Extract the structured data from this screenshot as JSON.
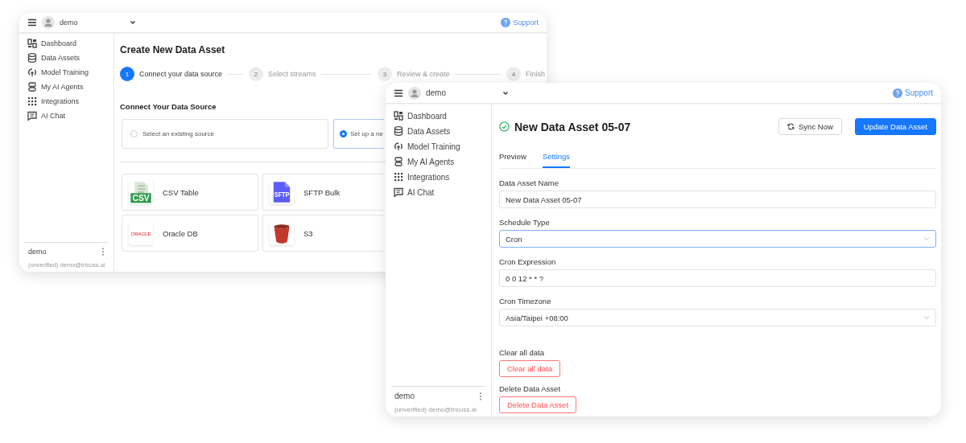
{
  "back_window": {
    "header": {
      "user": "demo",
      "support": "Support"
    },
    "sidebar": {
      "items": [
        {
          "label": "Dashboard",
          "selected": false
        },
        {
          "label": "Data Assets",
          "selected": false
        },
        {
          "label": "Model Training",
          "selected": false
        },
        {
          "label": "My AI Agents",
          "selected": false
        },
        {
          "label": "Integrations",
          "selected": false
        },
        {
          "label": "AI Chat",
          "selected": false
        }
      ],
      "user": {
        "name": "demo",
        "email": "(unverified) demo@tricuss.ai"
      }
    },
    "title": "Create New Data Asset",
    "steps": [
      {
        "number": "1",
        "label": "Connect your data source",
        "selected": true
      },
      {
        "number": "2",
        "label": "Select streams",
        "selected": false
      },
      {
        "number": "3",
        "label": "Review & create",
        "selected": false
      },
      {
        "number": "4",
        "label": "Finish",
        "selected": false
      }
    ],
    "section_title": "Connect Your Data Source",
    "source_options": [
      {
        "label": "Select an existing source",
        "selected": false
      },
      {
        "label": "Set up a ne",
        "selected": true
      }
    ],
    "sources": [
      {
        "kind": "csv",
        "name": "CSV Table",
        "logo_text": "CSV"
      },
      {
        "kind": "sftp",
        "name": "SFTP Bulk",
        "logo_text": "SFTP"
      },
      {
        "kind": "oracle",
        "name": "Oracle DB",
        "logo_text": "ORACLE"
      },
      {
        "kind": "s3",
        "name": "S3"
      }
    ]
  },
  "front_window": {
    "header": {
      "user": "demo",
      "support": "Support"
    },
    "sidebar": {
      "items": [
        {
          "label": "Dashboard",
          "selected": false
        },
        {
          "label": "Data Assets",
          "selected": false
        },
        {
          "label": "Model Training",
          "selected": false
        },
        {
          "label": "My AI Agents",
          "selected": false
        },
        {
          "label": "Integrations",
          "selected": false
        },
        {
          "label": "AI Chat",
          "selected": false
        }
      ],
      "user": {
        "name": "demo",
        "email": "(unverified) demo@tricuss.ai"
      }
    },
    "title": "New Data Asset 05-07",
    "buttons": {
      "sync": "Sync Now",
      "update": "Update Data Asset"
    },
    "tabs": [
      {
        "label": "Preview",
        "selected": false
      },
      {
        "label": "Settings",
        "selected": true
      }
    ],
    "fields": [
      {
        "kind": "input",
        "label": "Data Asset Name",
        "value": "New Data Asset 05-07",
        "focused": false
      },
      {
        "kind": "select",
        "label": "Schedule Type",
        "value": "Cron",
        "focused": true
      },
      {
        "kind": "input",
        "label": "Cron Expression",
        "value": "0 0 12 * * ?",
        "focused": false
      },
      {
        "kind": "select",
        "label": "Cron Timezone",
        "value": "Asia/Taipei +08:00",
        "focused": false
      }
    ],
    "danger_actions": [
      {
        "label": "Clear all data",
        "button": "Clear all data"
      },
      {
        "label": "Delete Data Asset",
        "button": "Delete Data Asset"
      }
    ]
  }
}
